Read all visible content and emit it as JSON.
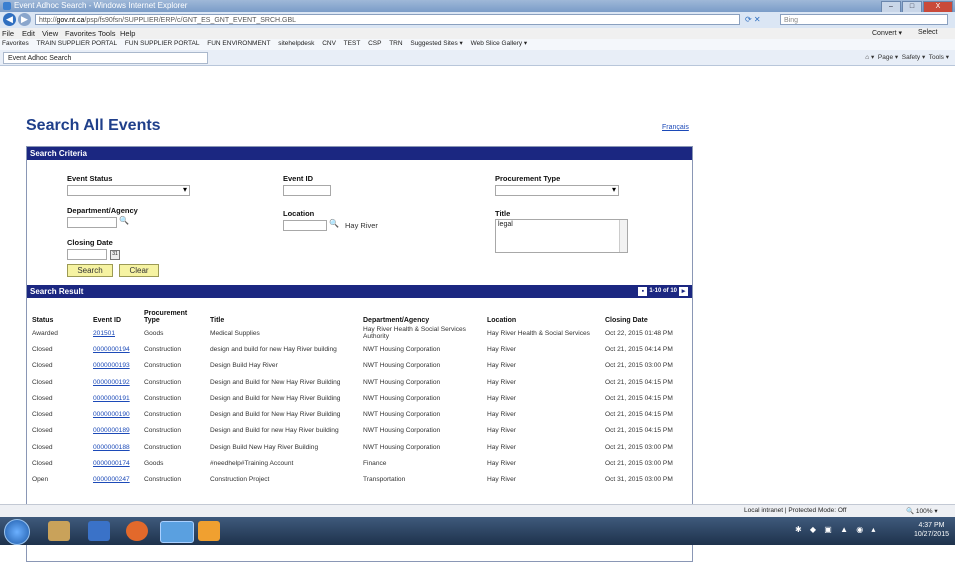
{
  "window": {
    "title": "Event Adhoc Search - Windows Internet Explorer",
    "controls": [
      "–",
      "□",
      "X"
    ]
  },
  "addressbar": {
    "url_prefix": "http://",
    "url_host": "gov.nt.ca",
    "url_path": "/psp/fs90fsn/SUPPLIER/ERP/c/GNT_ES_GNT_EVENT_SRCH.GBL",
    "search_placeholder": "Bing"
  },
  "menu": {
    "items": [
      "File",
      "Edit",
      "View",
      "Favorites",
      "Tools",
      "Help"
    ],
    "right_items": [
      "Convert ▾",
      "Select"
    ]
  },
  "favorites": {
    "label": "Favorites",
    "items": [
      "TRAIN SUPPLIER PORTAL",
      "FUN SUPPLIER PORTAL",
      "FUN ENVIRONMENT",
      "sitehelpdesk",
      "CNV",
      "TEST",
      "CSP",
      "TRN",
      "Suggested Sites ▾",
      "Web Slice Gallery ▾"
    ]
  },
  "tab": {
    "label": "Event Adhoc Search"
  },
  "commandbar": {
    "items": [
      "Page ▾",
      "Safety ▾",
      "Tools ▾"
    ]
  },
  "page": {
    "title": "Search All Events",
    "lang_link": "Français"
  },
  "criteria": {
    "header": "Search Criteria",
    "event_status_label": "Event Status",
    "event_status_value": "",
    "event_id_label": "Event ID",
    "event_id_value": "",
    "procurement_type_label": "Procurement Type",
    "procurement_type_value": "",
    "dept_label": "Department/Agency",
    "dept_value": "",
    "location_label": "Location",
    "location_value": "",
    "location_desc": "Hay River",
    "title_label": "Title",
    "title_value": "legal",
    "closing_date_label": "Closing Date",
    "closing_date_value": "",
    "search_button": "Search",
    "clear_button": "Clear"
  },
  "results": {
    "header": "Search Result",
    "pager_text": "1-10 of 10",
    "columns": [
      "Status",
      "Event ID",
      "Procurement Type",
      "Title",
      "Department/Agency",
      "Location",
      "Closing Date"
    ],
    "rows": [
      [
        "Awarded",
        "201501",
        "Goods",
        "Medical Supplies",
        "Hay River Health & Social Services Authority",
        "Hay River Health & Social Services",
        "Oct 22, 2015 01:48 PM"
      ],
      [
        "Closed",
        "0000000194",
        "Construction",
        "design and build for new Hay River building",
        "NWT Housing Corporation",
        "Hay River",
        "Oct 21, 2015 04:14 PM"
      ],
      [
        "Closed",
        "0000000193",
        "Construction",
        "Design Build Hay River",
        "NWT Housing Corporation",
        "Hay River",
        "Oct 21, 2015 03:00 PM"
      ],
      [
        "Closed",
        "0000000192",
        "Construction",
        "Design and Build for New Hay River Building",
        "NWT Housing Corporation",
        "Hay River",
        "Oct 21, 2015 04:15 PM"
      ],
      [
        "Closed",
        "0000000191",
        "Construction",
        "Design and Build for New Hay River Building",
        "NWT Housing Corporation",
        "Hay River",
        "Oct 21, 2015 04:15 PM"
      ],
      [
        "Closed",
        "0000000190",
        "Construction",
        "Design and Build for New Hay River Building",
        "NWT Housing Corporation",
        "Hay River",
        "Oct 21, 2015 04:15 PM"
      ],
      [
        "Closed",
        "0000000189",
        "Construction",
        "Design and Build for new Hay River building",
        "NWT Housing Corporation",
        "Hay River",
        "Oct 21, 2015 04:15 PM"
      ],
      [
        "Closed",
        "0000000188",
        "Construction",
        "Design Build New Hay River Building",
        "NWT Housing Corporation",
        "Hay River",
        "Oct 21, 2015 03:00 PM"
      ],
      [
        "Closed",
        "0000000174",
        "Goods",
        "#needhelp#Training Account",
        "Finance",
        "Hay River",
        "Oct 21, 2015 03:00 PM"
      ],
      [
        "Open",
        "0000000247",
        "Construction",
        "Construction Project",
        "Transportation",
        "Hay River",
        "Oct 31, 2015 03:00 PM"
      ]
    ]
  },
  "statusbar": {
    "zone": "Local intranet | Protected Mode: Off",
    "zoom": "100%"
  },
  "taskbar": {
    "time": "4:37 PM",
    "date": "10/27/2015"
  },
  "colors": {
    "header_bar": "#1b2781",
    "title": "#1f3f8a",
    "button": "#f6f3a2",
    "link": "#1c4ab8"
  }
}
